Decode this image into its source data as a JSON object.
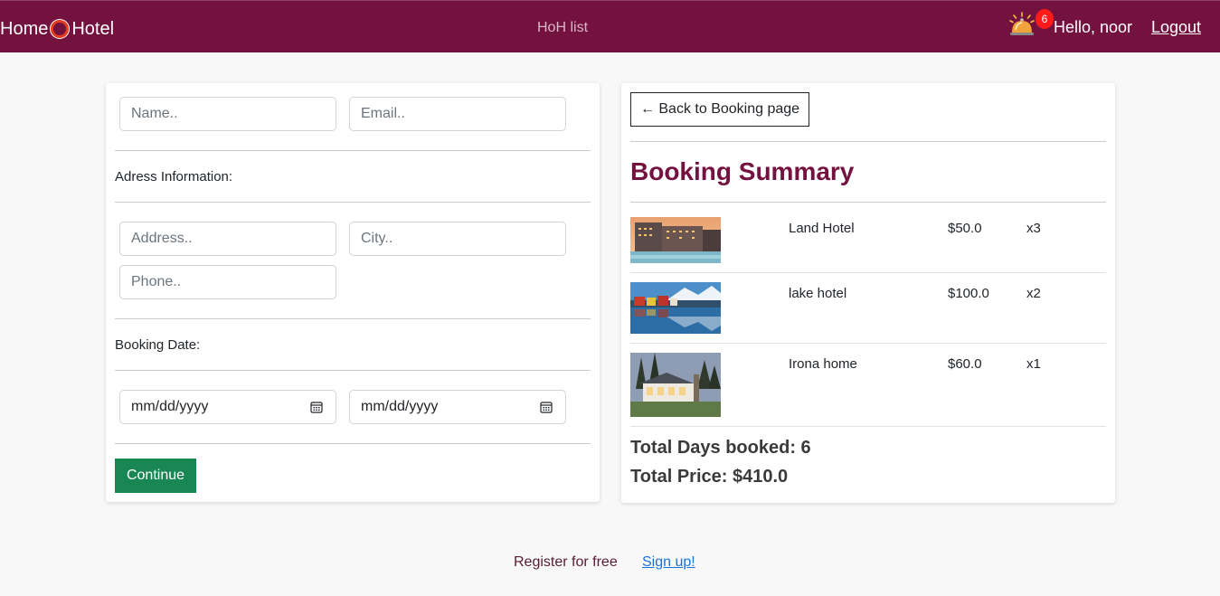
{
  "nav": {
    "brand_left": "Home",
    "brand_right": "Hotel",
    "link": "HoH list",
    "notification_count": "6",
    "greeting": "Hello, noor",
    "logout": "Logout"
  },
  "form": {
    "name_placeholder": "Name..",
    "email_placeholder": "Email..",
    "address_section": "Adress Information:",
    "address_placeholder": "Address..",
    "city_placeholder": "City..",
    "phone_placeholder": "Phone..",
    "date_section": "Booking Date:",
    "start_date": "mm/dd/yyyy",
    "end_date": "mm/dd/yyyy",
    "continue": "Continue"
  },
  "summary": {
    "back": "← Back to Booking page",
    "title": "Booking Summary",
    "items": [
      {
        "name": "Land Hotel",
        "price": "$50.0",
        "qty": "x3",
        "image": "hotel-pool-image"
      },
      {
        "name": "lake hotel",
        "price": "$100.0",
        "qty": "x2",
        "image": "lake-houses-image"
      },
      {
        "name": "Irona home",
        "price": "$60.0",
        "qty": "x1",
        "image": "house-forest-image"
      }
    ],
    "total_days": "Total Days booked: 6",
    "total_price": "Total Price: $410.0"
  },
  "footer": {
    "register_text": "Register for free",
    "signup": "Sign up!"
  },
  "colors": {
    "brand": "#73123f",
    "continue": "#198754",
    "badge": "#ff1a1a",
    "link": "#1a73d9"
  }
}
